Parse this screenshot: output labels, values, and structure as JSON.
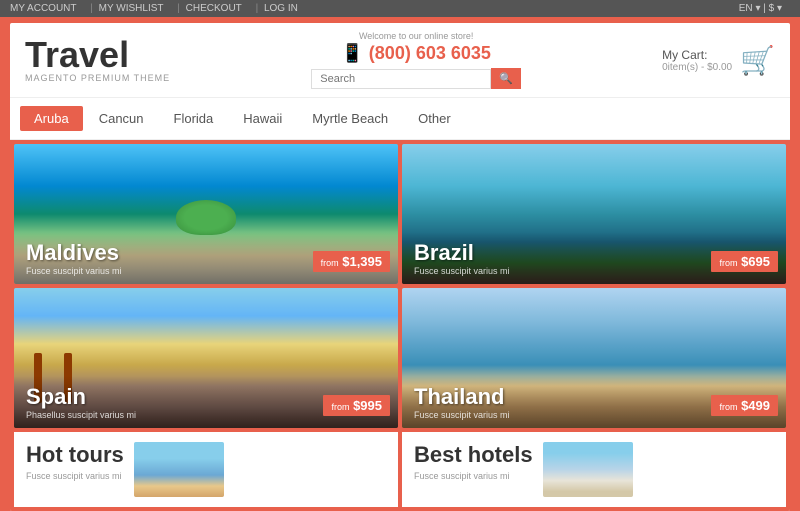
{
  "topbar": {
    "links": [
      "MY ACCOUNT",
      "MY WISHLIST",
      "CHECKOUT",
      "LOG IN"
    ],
    "lang": "EN",
    "currency": "$"
  },
  "header": {
    "logo": "Travel",
    "logo_subtitle": "MAGENTO PREMIUM THEME",
    "welcome": "Welcome to our online store!",
    "phone": "(800) 603 6035",
    "search_placeholder": "Search",
    "cart_label": "My Cart:",
    "cart_price": "0item(s) - $0.00"
  },
  "nav": {
    "tabs": [
      {
        "label": "Aruba",
        "active": true
      },
      {
        "label": "Cancun",
        "active": false
      },
      {
        "label": "Florida",
        "active": false
      },
      {
        "label": "Hawaii",
        "active": false
      },
      {
        "label": "Myrtle Beach",
        "active": false
      },
      {
        "label": "Other",
        "active": false
      }
    ]
  },
  "destinations": [
    {
      "name": "Maldives",
      "subtitle": "Fusce suscipit varius mi",
      "from_label": "from",
      "price": "$1,395",
      "bg_class": "maldives-bg"
    },
    {
      "name": "Brazil",
      "subtitle": "Fusce suscipit varius mi",
      "from_label": "from",
      "price": "$695",
      "bg_class": "brazil-bg"
    },
    {
      "name": "Spain",
      "subtitle": "Phasellus suscipit varius mi",
      "from_label": "from",
      "price": "$995",
      "bg_class": "spain-bg"
    },
    {
      "name": "Thailand",
      "subtitle": "Fusce suscipit varius mi",
      "from_label": "from",
      "price": "$499",
      "bg_class": "thailand-bg"
    }
  ],
  "bottom_cards": [
    {
      "title": "Hot tours",
      "subtitle": "Fusce suscipit varius mi",
      "thumb_class": "hot-tours-thumb"
    },
    {
      "title": "Best hotels",
      "subtitle": "Fusce suscipit varius mi",
      "thumb_class": "best-hotels-thumb"
    }
  ]
}
